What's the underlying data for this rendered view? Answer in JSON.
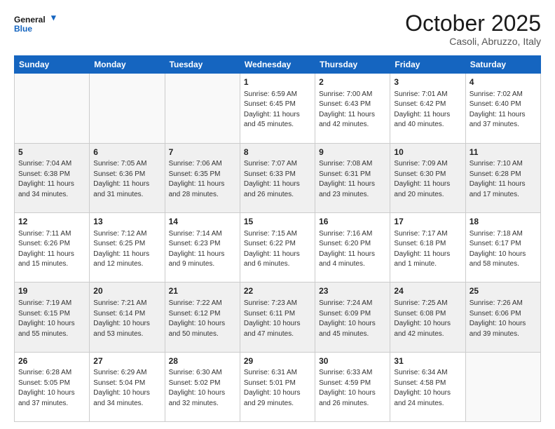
{
  "logo": {
    "general": "General",
    "blue": "Blue"
  },
  "header": {
    "month": "October 2025",
    "location": "Casoli, Abruzzo, Italy"
  },
  "days_of_week": [
    "Sunday",
    "Monday",
    "Tuesday",
    "Wednesday",
    "Thursday",
    "Friday",
    "Saturday"
  ],
  "weeks": [
    [
      {
        "day": "",
        "info": ""
      },
      {
        "day": "",
        "info": ""
      },
      {
        "day": "",
        "info": ""
      },
      {
        "day": "1",
        "info": "Sunrise: 6:59 AM\nSunset: 6:45 PM\nDaylight: 11 hours and 45 minutes."
      },
      {
        "day": "2",
        "info": "Sunrise: 7:00 AM\nSunset: 6:43 PM\nDaylight: 11 hours and 42 minutes."
      },
      {
        "day": "3",
        "info": "Sunrise: 7:01 AM\nSunset: 6:42 PM\nDaylight: 11 hours and 40 minutes."
      },
      {
        "day": "4",
        "info": "Sunrise: 7:02 AM\nSunset: 6:40 PM\nDaylight: 11 hours and 37 minutes."
      }
    ],
    [
      {
        "day": "5",
        "info": "Sunrise: 7:04 AM\nSunset: 6:38 PM\nDaylight: 11 hours and 34 minutes."
      },
      {
        "day": "6",
        "info": "Sunrise: 7:05 AM\nSunset: 6:36 PM\nDaylight: 11 hours and 31 minutes."
      },
      {
        "day": "7",
        "info": "Sunrise: 7:06 AM\nSunset: 6:35 PM\nDaylight: 11 hours and 28 minutes."
      },
      {
        "day": "8",
        "info": "Sunrise: 7:07 AM\nSunset: 6:33 PM\nDaylight: 11 hours and 26 minutes."
      },
      {
        "day": "9",
        "info": "Sunrise: 7:08 AM\nSunset: 6:31 PM\nDaylight: 11 hours and 23 minutes."
      },
      {
        "day": "10",
        "info": "Sunrise: 7:09 AM\nSunset: 6:30 PM\nDaylight: 11 hours and 20 minutes."
      },
      {
        "day": "11",
        "info": "Sunrise: 7:10 AM\nSunset: 6:28 PM\nDaylight: 11 hours and 17 minutes."
      }
    ],
    [
      {
        "day": "12",
        "info": "Sunrise: 7:11 AM\nSunset: 6:26 PM\nDaylight: 11 hours and 15 minutes."
      },
      {
        "day": "13",
        "info": "Sunrise: 7:12 AM\nSunset: 6:25 PM\nDaylight: 11 hours and 12 minutes."
      },
      {
        "day": "14",
        "info": "Sunrise: 7:14 AM\nSunset: 6:23 PM\nDaylight: 11 hours and 9 minutes."
      },
      {
        "day": "15",
        "info": "Sunrise: 7:15 AM\nSunset: 6:22 PM\nDaylight: 11 hours and 6 minutes."
      },
      {
        "day": "16",
        "info": "Sunrise: 7:16 AM\nSunset: 6:20 PM\nDaylight: 11 hours and 4 minutes."
      },
      {
        "day": "17",
        "info": "Sunrise: 7:17 AM\nSunset: 6:18 PM\nDaylight: 11 hours and 1 minute."
      },
      {
        "day": "18",
        "info": "Sunrise: 7:18 AM\nSunset: 6:17 PM\nDaylight: 10 hours and 58 minutes."
      }
    ],
    [
      {
        "day": "19",
        "info": "Sunrise: 7:19 AM\nSunset: 6:15 PM\nDaylight: 10 hours and 55 minutes."
      },
      {
        "day": "20",
        "info": "Sunrise: 7:21 AM\nSunset: 6:14 PM\nDaylight: 10 hours and 53 minutes."
      },
      {
        "day": "21",
        "info": "Sunrise: 7:22 AM\nSunset: 6:12 PM\nDaylight: 10 hours and 50 minutes."
      },
      {
        "day": "22",
        "info": "Sunrise: 7:23 AM\nSunset: 6:11 PM\nDaylight: 10 hours and 47 minutes."
      },
      {
        "day": "23",
        "info": "Sunrise: 7:24 AM\nSunset: 6:09 PM\nDaylight: 10 hours and 45 minutes."
      },
      {
        "day": "24",
        "info": "Sunrise: 7:25 AM\nSunset: 6:08 PM\nDaylight: 10 hours and 42 minutes."
      },
      {
        "day": "25",
        "info": "Sunrise: 7:26 AM\nSunset: 6:06 PM\nDaylight: 10 hours and 39 minutes."
      }
    ],
    [
      {
        "day": "26",
        "info": "Sunrise: 6:28 AM\nSunset: 5:05 PM\nDaylight: 10 hours and 37 minutes."
      },
      {
        "day": "27",
        "info": "Sunrise: 6:29 AM\nSunset: 5:04 PM\nDaylight: 10 hours and 34 minutes."
      },
      {
        "day": "28",
        "info": "Sunrise: 6:30 AM\nSunset: 5:02 PM\nDaylight: 10 hours and 32 minutes."
      },
      {
        "day": "29",
        "info": "Sunrise: 6:31 AM\nSunset: 5:01 PM\nDaylight: 10 hours and 29 minutes."
      },
      {
        "day": "30",
        "info": "Sunrise: 6:33 AM\nSunset: 4:59 PM\nDaylight: 10 hours and 26 minutes."
      },
      {
        "day": "31",
        "info": "Sunrise: 6:34 AM\nSunset: 4:58 PM\nDaylight: 10 hours and 24 minutes."
      },
      {
        "day": "",
        "info": ""
      }
    ]
  ],
  "shading": [
    false,
    true,
    false,
    true,
    false
  ]
}
